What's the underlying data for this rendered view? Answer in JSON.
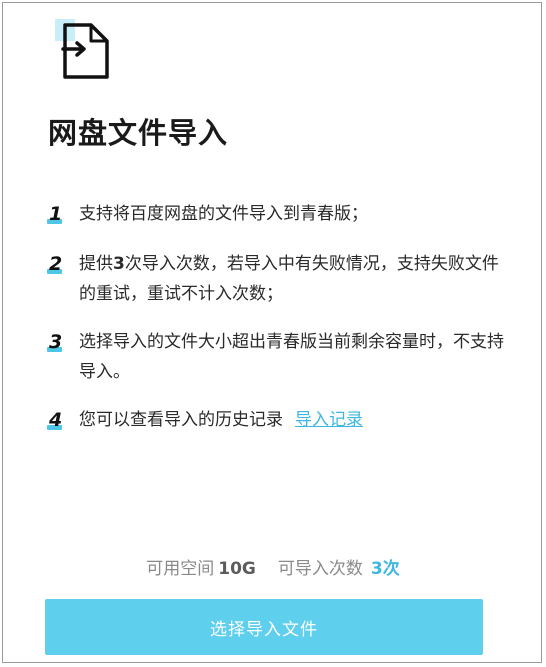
{
  "header": {
    "icon": "file-import-icon",
    "title": "网盘文件导入"
  },
  "instructions": {
    "items": [
      {
        "number": "1",
        "text": "支持将百度网盘的文件导入到青春版；"
      },
      {
        "number": "2",
        "text_prefix": "提供",
        "count": "3",
        "text_suffix": "次导入次数，若导入中有失败情况，支持失败文件的重试，重试不计入次数；"
      },
      {
        "number": "3",
        "text": "选择导入的文件大小超出青春版当前剩余容量时，不支持导入。"
      },
      {
        "number": "4",
        "text": "您可以查看导入的历史记录",
        "link_label": "导入记录"
      }
    ]
  },
  "stats": {
    "space_label": "可用空间",
    "space_value": "10G",
    "count_label": "可导入次数",
    "count_value": "3次"
  },
  "actions": {
    "select_files_label": "选择导入文件"
  },
  "colors": {
    "accent": "#5fcfee",
    "link": "#3fb7e0",
    "number_mark": "#4ec6e6"
  }
}
